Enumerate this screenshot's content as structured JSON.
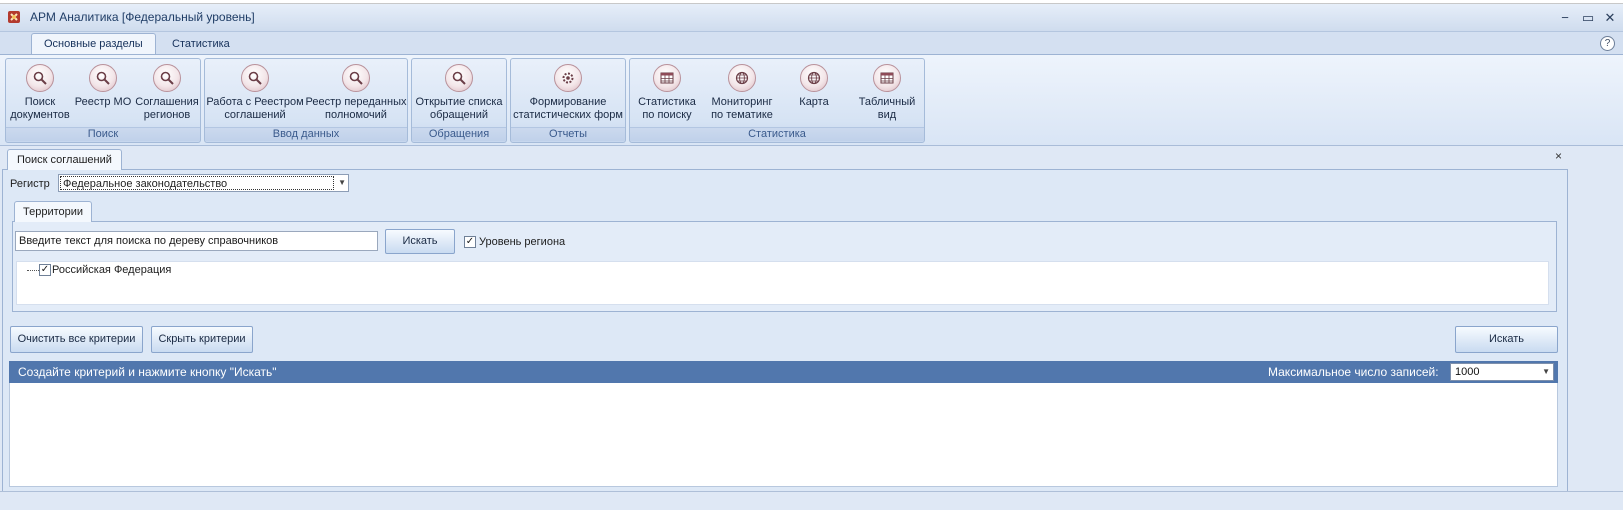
{
  "window": {
    "title": "АРМ Аналитика [Федеральный уровень]",
    "controls": {
      "minimize": "−",
      "maximize": "▭",
      "close": "✕"
    }
  },
  "ribbon_tabs": [
    {
      "label": "Основные разделы",
      "active": true
    },
    {
      "label": "Статистика",
      "active": false
    }
  ],
  "help_label": "?",
  "ribbon_groups": [
    {
      "label": "Поиск",
      "buttons": [
        {
          "label": "Поиск\nдокументов",
          "icon": "magnifier-icon"
        },
        {
          "label": "Реестр МО",
          "icon": "magnifier-icon"
        },
        {
          "label": "Соглашения\nрегионов",
          "icon": "magnifier-icon"
        }
      ]
    },
    {
      "label": "Ввод данных",
      "buttons": [
        {
          "label": "Работа с Реестром\nсоглашений",
          "icon": "magnifier-icon"
        },
        {
          "label": "Реестр переданных\nполномочий",
          "icon": "magnifier-icon"
        }
      ]
    },
    {
      "label": "Обращения",
      "buttons": [
        {
          "label": "Открытие списка\nобращений",
          "icon": "magnifier-icon"
        }
      ]
    },
    {
      "label": "Отчеты",
      "buttons": [
        {
          "label": "Формирование\nстатистических форм",
          "icon": "gear-icon"
        }
      ]
    },
    {
      "label": "Статистика",
      "buttons": [
        {
          "label": "Статистика\nпо поиску",
          "icon": "table-icon"
        },
        {
          "label": "Мониторинг\nпо тематике",
          "icon": "globe-icon"
        },
        {
          "label": "Карта",
          "icon": "globe-icon"
        },
        {
          "label": "Табличный\nвид",
          "icon": "table-icon"
        }
      ]
    }
  ],
  "document_tab": {
    "label": "Поиск соглашений",
    "close": "×"
  },
  "registr": {
    "label": "Регистр",
    "value": "Федеральное законодательство"
  },
  "territories": {
    "tab_label": "Территории",
    "search_value": "Введите текст для поиска по дереву справочников",
    "search_button": "Искать",
    "region_level": {
      "label": "Уровень региона",
      "checked": true
    },
    "tree": [
      {
        "label": "Российская Федерация",
        "checked": true
      }
    ]
  },
  "actions": {
    "clear_all": "Очистить все критерии",
    "hide_criteria": "Скрыть критерии",
    "search": "Искать"
  },
  "results": {
    "hint": "Создайте критерий и нажмите кнопку \"Искать\"",
    "max_label": "Максимальное число записей:",
    "max_value": "1000"
  },
  "colors": {
    "results_header": "#5177ad",
    "panel_bg": "#dde8f6",
    "ribbon_group_border": "#a5bbd9"
  }
}
